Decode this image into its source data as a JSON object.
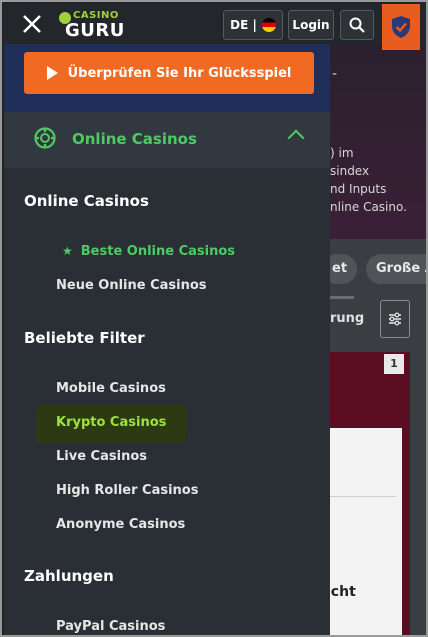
{
  "header": {
    "logo_top": "CASINO",
    "logo_bottom": "GURU",
    "language": "DE |",
    "login_label": "Login"
  },
  "cta": {
    "label": "Überprüfen Sie Ihr Glücksspiel"
  },
  "menu": {
    "section_title": "Online Casinos",
    "groups": [
      {
        "title": "Online Casinos",
        "items": [
          {
            "label": "Beste Online Casinos",
            "active": true
          },
          {
            "label": "Neue Online Casinos",
            "active": false
          }
        ]
      },
      {
        "title": "Beliebte Filter",
        "items": [
          {
            "label": "Mobile Casinos"
          },
          {
            "label": "Krypto Casinos",
            "highlighted": true
          },
          {
            "label": "Live Casinos"
          },
          {
            "label": "High Roller Casinos"
          },
          {
            "label": "Anonyme Casinos"
          }
        ]
      },
      {
        "title": "Zahlungen",
        "items": [
          {
            "label": "PayPal Casinos"
          }
        ]
      }
    ]
  },
  "background": {
    "dash": "-",
    "hero_text": ") im\nsindex\nnd Inputs\nnline Casino.",
    "chips": [
      "et",
      "Große A"
    ],
    "sort_label": "rung",
    "rank": "1",
    "card_text": "icht"
  },
  "colors": {
    "accent_orange": "#f06a24",
    "accent_green": "#4fc964",
    "cta_band": "#202e5a",
    "highlight_green": "#9fe33a"
  }
}
